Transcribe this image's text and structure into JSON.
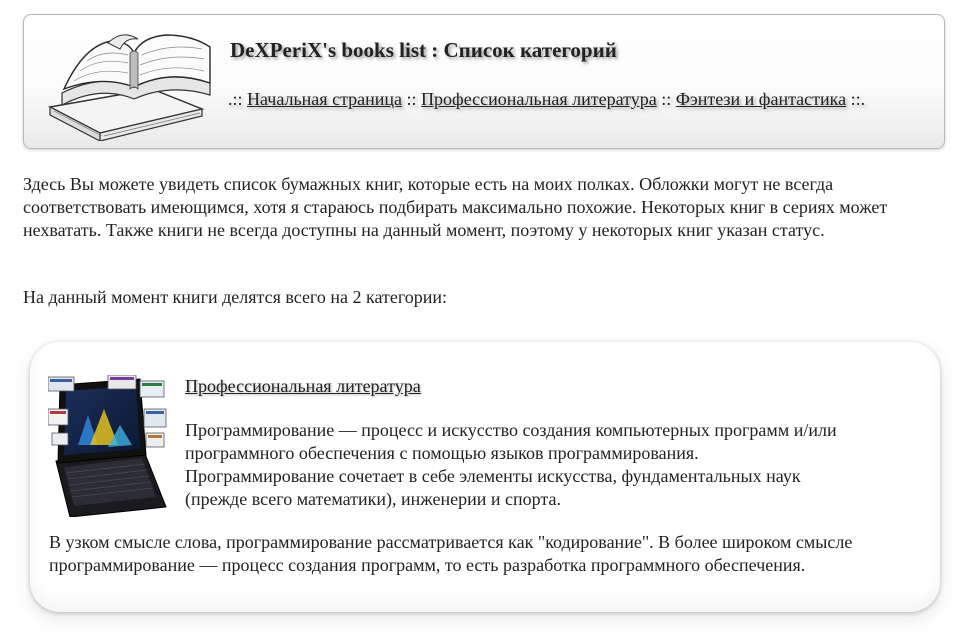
{
  "header": {
    "title": "DeXPeriX's books list : Список категорий",
    "nav_prefix": ".::",
    "nav_sep": "::",
    "nav_suffix": "::.",
    "nav": [
      {
        "label": "Начальная страница"
      },
      {
        "label": "Профессиональная литература"
      },
      {
        "label": "Фэнтези и фантастика"
      }
    ]
  },
  "intro": {
    "text": "Здесь Вы можете увидеть список бумажных книг, которые есть на моих полках. Обложки могут не всегда соответствовать имеющимся, хотя я стараюсь подбирать максимально похожие. Некоторых книг в сериях может нехватать. Также книги не всегда доступны на данный момент, поэтому у некоторых книг указан статус.",
    "count_text": "На данный момент книги делятся всего на 2 категории:"
  },
  "categories": [
    {
      "title": "Профессиональная литература",
      "description_lines": [
        "Программирование — процесс и искусство создания компьютерных программ и/или",
        "программного обеспечения с помощью языков программирования.",
        "Программирование сочетает в себе элементы искусства, фундаментальных наук",
        "(прежде всего математики), инженерии и спорта."
      ],
      "description2": "В узком смысле слова, программирование рассматривается как \"кодирование\". В более широком смысле программирование — процесс создания программ, то есть разработка программного обеспечения."
    }
  ]
}
